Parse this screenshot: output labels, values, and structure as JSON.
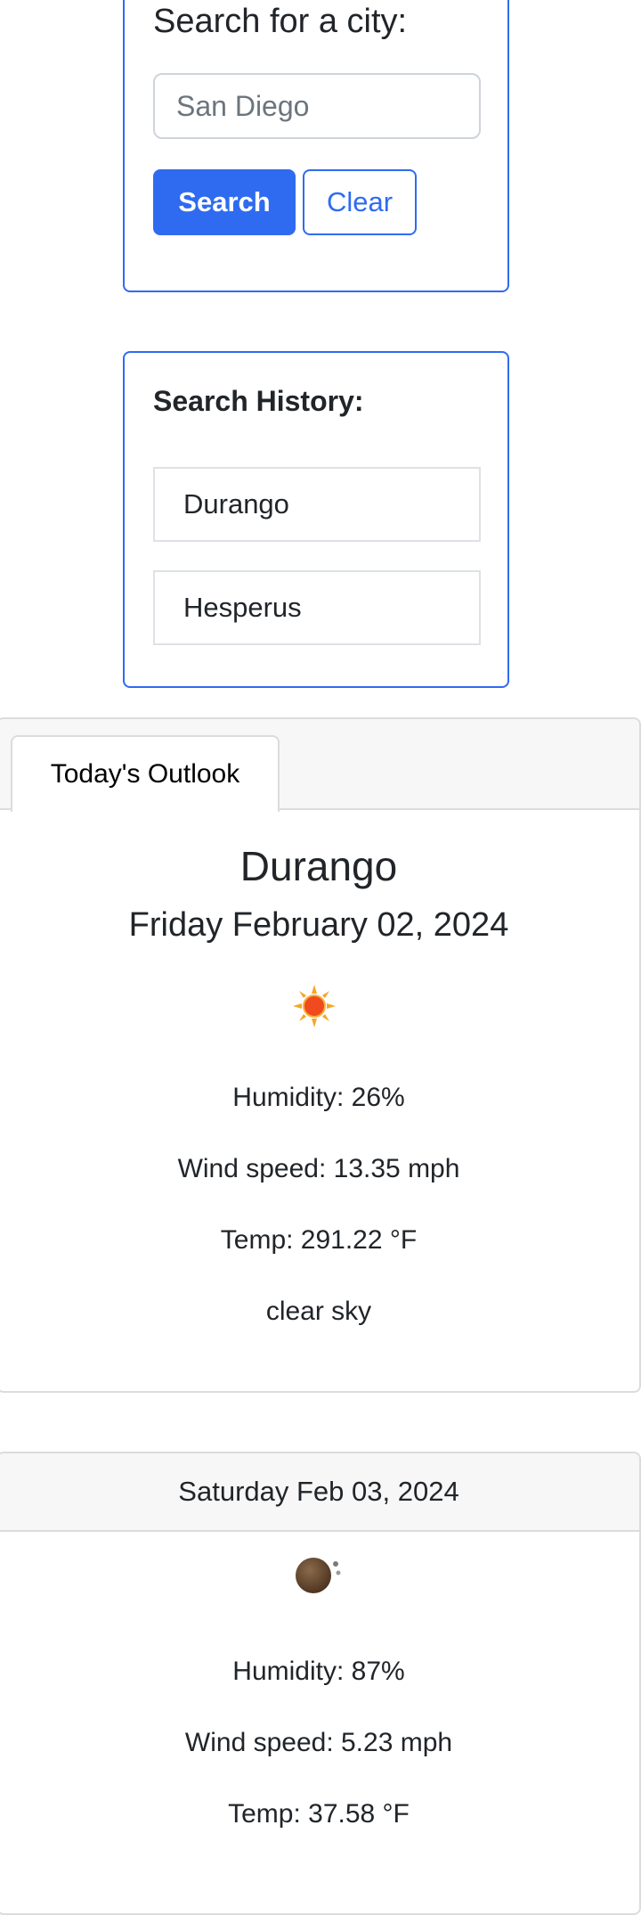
{
  "search": {
    "title": "Search for a city:",
    "input_placeholder": "San Diego",
    "search_label": "Search",
    "clear_label": "Clear"
  },
  "history": {
    "title": "Search History:",
    "items": [
      "Durango",
      "Hesperus"
    ]
  },
  "today": {
    "tab_label": "Today's Outlook",
    "city": "Durango",
    "date": "Friday February 02, 2024",
    "icon": "clear-sky-sun-icon",
    "humidity": "Humidity: 26%",
    "wind": "Wind speed: 13.35 mph",
    "temp": "Temp: 291.22 °F",
    "description": "clear sky"
  },
  "forecast": [
    {
      "date": "Saturday Feb 03, 2024",
      "icon": "night-cloud-icon",
      "humidity": "Humidity: 87%",
      "wind": "Wind speed: 5.23 mph",
      "temp": "Temp: 37.58 °F"
    }
  ],
  "colors": {
    "primary": "#2f6bf0",
    "card_border": "#dadcdf",
    "card_header": "#f7f7f7",
    "text": "#212529"
  }
}
